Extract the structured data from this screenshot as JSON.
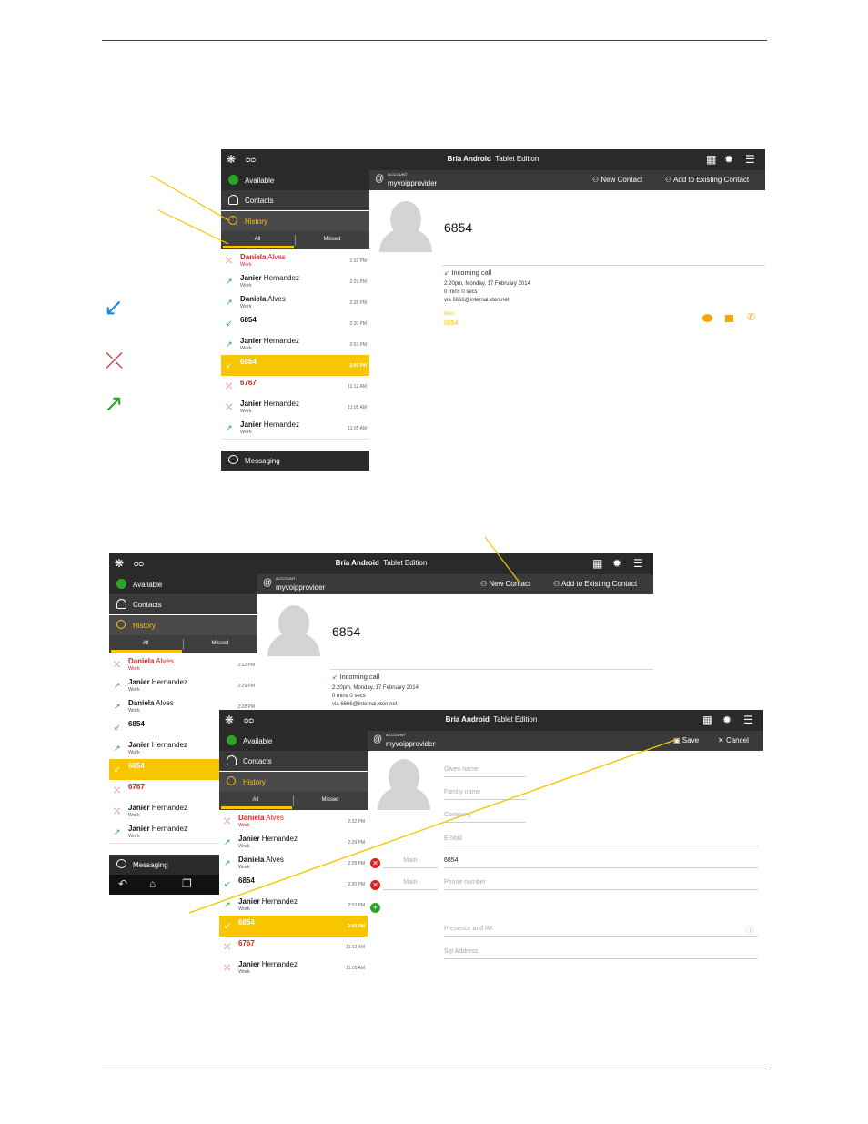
{
  "app": {
    "title_bold": "Bria Android",
    "title_rest": "Tablet Edition",
    "grid_icon": "grid-icon",
    "settings_icon": "gear-icon",
    "menu_icon": "hamburger-icon",
    "voicemail_icon": "voicemail-icon"
  },
  "sidebar": {
    "available": "Available",
    "contacts": "Contacts",
    "history": "History",
    "messaging": "Messaging",
    "tab_all": "All",
    "tab_missed": "Missed"
  },
  "account": {
    "small_label": "ACCOUNT",
    "provider": "myvoipprovider",
    "new_contact": "New Contact",
    "add_existing": "Add to Existing Contact",
    "save": "Save",
    "cancel": "Cancel"
  },
  "history": [
    {
      "name_first": "Daniela",
      "name_last": "Alves",
      "sub": "Work",
      "time": "2:32 PM",
      "type": "missed"
    },
    {
      "name_first": "Janier",
      "name_last": "Hernandez",
      "sub": "Work",
      "time": "2:29 PM",
      "type": "outgoing"
    },
    {
      "name_first": "Daniela",
      "name_last": "Alves",
      "sub": "Work",
      "time": "2:28 PM",
      "type": "outgoing"
    },
    {
      "name_first": "6854",
      "name_last": "",
      "sub": "",
      "time": "2:20 PM",
      "type": "incoming"
    },
    {
      "name_first": "Janier",
      "name_last": "Hernandez",
      "sub": "Work",
      "time": "2:03 PM",
      "type": "outgoing"
    },
    {
      "name_first": "6854",
      "name_last": "",
      "sub": "",
      "time": "2:00 PM",
      "type": "incoming"
    },
    {
      "name_first": "6767",
      "name_last": "",
      "sub": "",
      "time": "11:12 AM",
      "type": "missed"
    },
    {
      "name_first": "Janier",
      "name_last": "Hernandez",
      "sub": "Work",
      "time": "11:05 AM",
      "type": "missed-multi"
    },
    {
      "name_first": "Janier",
      "name_last": "Hernandez",
      "sub": "Work",
      "time": "11:05 AM",
      "type": "outgoing"
    }
  ],
  "detail": {
    "name": "6854",
    "call_type": "Incoming call",
    "when": "2:20pm, Monday, 17 February 2014",
    "duration": "0 mins 0 secs",
    "via": "via 6666@internal.xten.net",
    "number_label": "Main",
    "number": "6854"
  },
  "form": {
    "given_name": "Given name",
    "family_name": "Family name",
    "company": "Company",
    "email": "E-Mail",
    "phone_label": "Main",
    "phone_value": "6854",
    "phone_placeholder": "Phone number",
    "presence": "Presence and IM",
    "sip": "Sip Address"
  },
  "colors": {
    "accent": "#f7c600",
    "dark": "#2a2a2a",
    "missed": "#d62020",
    "outgoing": "#2aa52a",
    "incoming": "#1e88e5"
  }
}
